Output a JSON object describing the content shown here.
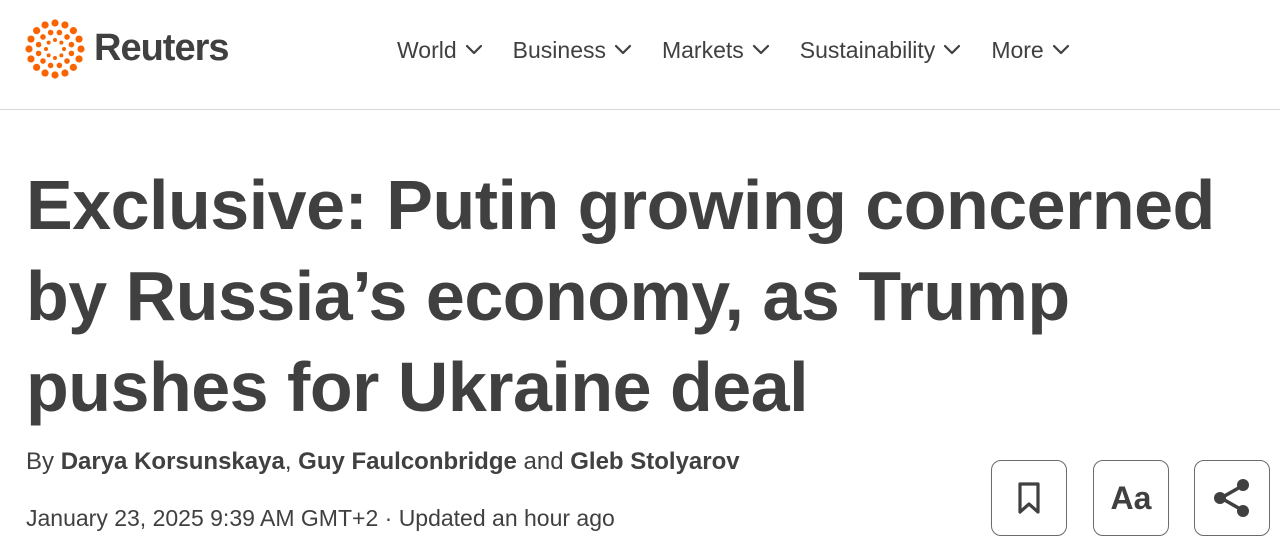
{
  "brand": {
    "name": "Reuters",
    "accent_color": "#fa6400",
    "text_color": "#404040"
  },
  "nav": {
    "items": [
      {
        "label": "World",
        "icon": "chevron-down-icon"
      },
      {
        "label": "Business",
        "icon": "chevron-down-icon"
      },
      {
        "label": "Markets",
        "icon": "chevron-down-icon"
      },
      {
        "label": "Sustainability",
        "icon": "chevron-down-icon"
      },
      {
        "label": "More",
        "icon": "chevron-down-icon"
      }
    ]
  },
  "article": {
    "headline": "Exclusive: Putin growing concerned by Russia’s economy, as Trump pushes for Ukraine deal",
    "byline": {
      "prefix": "By ",
      "authors": [
        "Darya Korsunskaya",
        "Guy Faulconbridge",
        "Gleb Stolyarov"
      ],
      "separator": ", ",
      "conjunction": " and "
    },
    "timestamp": "January 23, 2025 9:39 AM GMT+2",
    "dot": " · ",
    "updated": "Updated an hour ago"
  },
  "toolbar": {
    "bookmark_icon": "bookmark-icon",
    "text_size_label": "Aa",
    "share_icon": "share-icon"
  }
}
